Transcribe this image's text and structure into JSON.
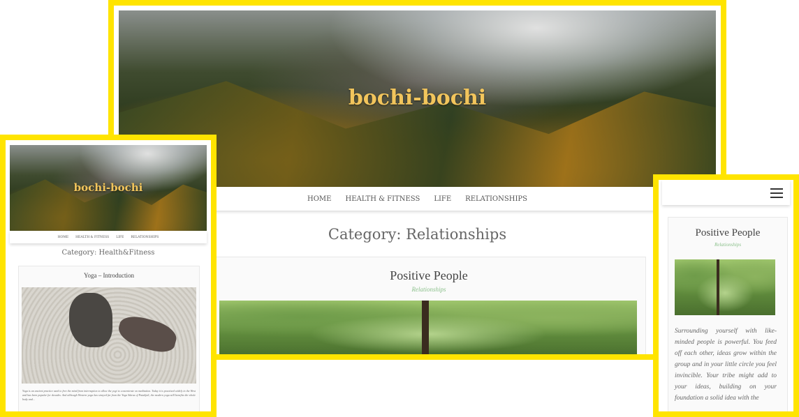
{
  "site": {
    "title": "bochi-bochi"
  },
  "nav": {
    "items": [
      "HOME",
      "HEALTH & FITNESS",
      "LIFE",
      "RELATIONSHIPS"
    ]
  },
  "desktop": {
    "category_title": "Category: Relationships",
    "post": {
      "title": "Positive People",
      "category": "Relationships"
    }
  },
  "tablet": {
    "category_title": "Category: Health&Fitness",
    "post": {
      "title": "Yoga – Introduction",
      "excerpt": "Yoga is an ancient practice used to free the mind from interruption to allow the yogi to concentrate on meditation. Today it is practised widely in the West and has been popular for decades. And although Western yoga has strayed far from the Yoga Sūtras of Patañjali, the modern yoga still benefits the whole body and…"
    }
  },
  "mobile": {
    "post": {
      "title": "Positive People",
      "category": "Relationships",
      "excerpt": "Surrounding yourself with like-minded people is powerful. You feed off each other, ideas grow within the group and in your little circle you feel invincible. Your tribe might add to your ideas, building on your foundation a solid idea with the"
    }
  },
  "colors": {
    "frame": "#ffe400",
    "title": "#f2c55c",
    "category_link": "#8bc08b"
  }
}
